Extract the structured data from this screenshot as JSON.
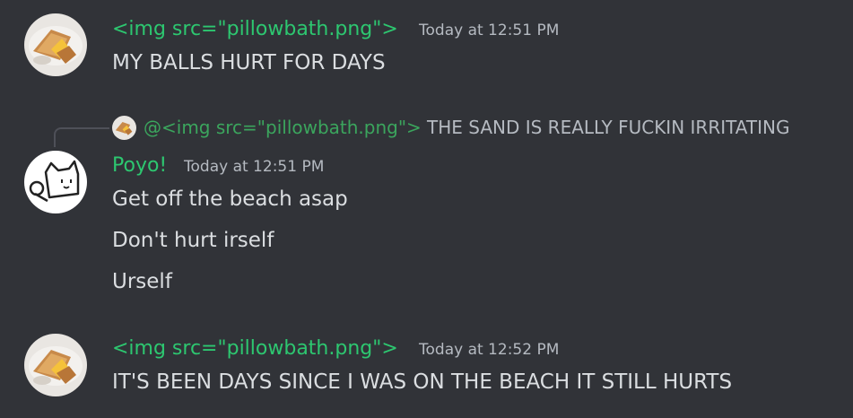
{
  "colors": {
    "background": "#313338",
    "username_green": "#2dc770",
    "mention_green": "#3ba55d",
    "message_text": "#dbdee1",
    "muted_text": "#b5bac1"
  },
  "messages": [
    {
      "author": "<img src=\"pillowbath.png\">",
      "timestamp": "Today at 12:51 PM",
      "avatar_icon": "grilled-cheese-icon",
      "lines": [
        "MY BALLS HURT FOR DAYS"
      ]
    },
    {
      "reply": {
        "avatar_icon": "grilled-cheese-icon",
        "mention": "@<img src=\"pillowbath.png\">",
        "text": "THE SAND IS REALLY FUCKIN IRRITATING"
      },
      "author": "Poyo!",
      "timestamp": "Today at 12:51 PM",
      "avatar_icon": "cat-doodle-icon",
      "lines": [
        "Get off the beach asap",
        "Don't hurt irself",
        "Urself"
      ]
    },
    {
      "author": "<img src=\"pillowbath.png\">",
      "timestamp": "Today at 12:52 PM",
      "avatar_icon": "grilled-cheese-icon",
      "lines": [
        "IT'S BEEN DAYS SINCE I WAS ON THE BEACH IT STILL HURTS"
      ]
    }
  ]
}
